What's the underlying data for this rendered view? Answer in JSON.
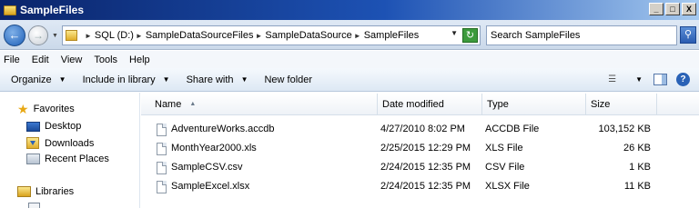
{
  "window": {
    "title": "SampleFiles",
    "controls": [
      "_",
      "□",
      "X"
    ]
  },
  "address": {
    "crumbs": [
      "SQL (D:)",
      "SampleDataSourceFiles",
      "SampleDataSource",
      "SampleFiles"
    ]
  },
  "search": {
    "placeholder": "Search SampleFiles"
  },
  "menu": [
    "File",
    "Edit",
    "View",
    "Tools",
    "Help"
  ],
  "commands": {
    "organize": "Organize",
    "include": "Include in library",
    "share": "Share with",
    "newfolder": "New folder"
  },
  "nav": {
    "favorites": "Favorites",
    "desktop": "Desktop",
    "downloads": "Downloads",
    "recent": "Recent Places",
    "libraries": "Libraries"
  },
  "columns": {
    "name": "Name",
    "date": "Date modified",
    "type": "Type",
    "size": "Size"
  },
  "files": [
    {
      "name": "AdventureWorks.accdb",
      "date": "4/27/2010 8:02 PM",
      "type": "ACCDB File",
      "size": "103,152 KB"
    },
    {
      "name": "MonthYear2000.xls",
      "date": "2/25/2015 12:29 PM",
      "type": "XLS File",
      "size": "26 KB"
    },
    {
      "name": "SampleCSV.csv",
      "date": "2/24/2015 12:35 PM",
      "type": "CSV File",
      "size": "1 KB"
    },
    {
      "name": "SampleExcel.xlsx",
      "date": "2/24/2015 12:35 PM",
      "type": "XLSX File",
      "size": "11 KB"
    }
  ],
  "icons": {
    "back": "back-arrow-icon",
    "forward": "forward-arrow-icon",
    "refresh": "refresh-icon",
    "search": "search-icon",
    "views": "views-icon",
    "preview_pane": "preview-pane-icon",
    "help": "help-icon"
  },
  "colors": {
    "titlebar": "#0a246a",
    "toolbar": "#dde8f4",
    "accent": "#2a62b6"
  }
}
